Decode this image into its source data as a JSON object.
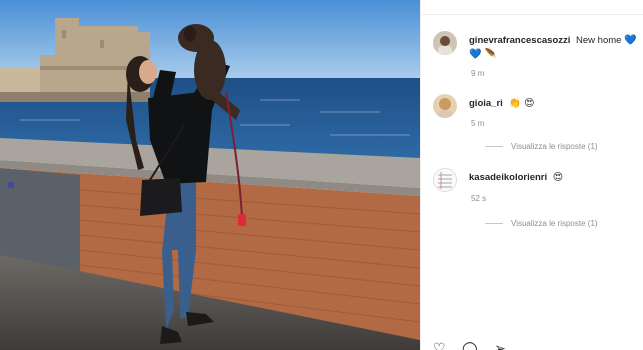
{
  "post": {
    "photo": {
      "description_icon": "photo-of-woman-holding-puppy-by-seafront"
    },
    "comments": [
      {
        "username": "ginevrafrancescasozzi",
        "text": "New home",
        "emoji": "💙 💙 🪶",
        "time": "9 m",
        "avatar": "avatar-photo"
      },
      {
        "username": "gioia_ri",
        "text": "",
        "emoji": "👏 😍",
        "time": "5 m",
        "replies_label": "Visualizza le risposte (1)",
        "avatar": "avatar-photo"
      },
      {
        "username": "kasadeikolorienri",
        "text": "",
        "emoji": "😍",
        "time": "52 s",
        "replies_label": "Visualizza le risposte (1)",
        "avatar": "avatar-notebook"
      }
    ],
    "actions": [
      "heart-icon",
      "comment-icon",
      "share-icon"
    ]
  }
}
